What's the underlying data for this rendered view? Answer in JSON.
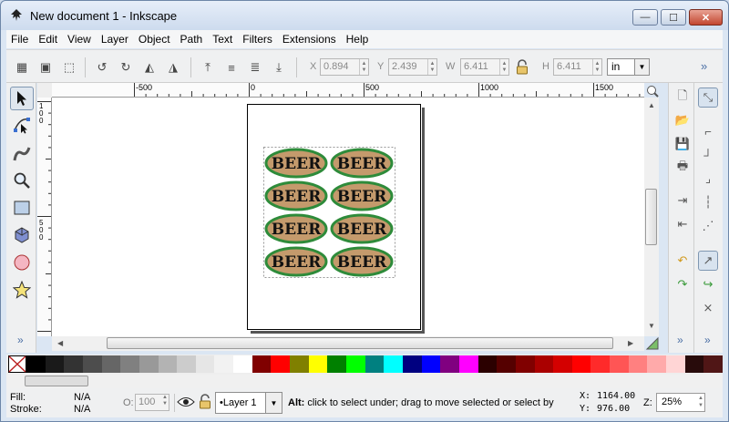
{
  "window": {
    "title": "New document 1 - Inkscape",
    "minimize": "—",
    "maximize": "☐",
    "close": "✕"
  },
  "menu": [
    "File",
    "Edit",
    "View",
    "Layer",
    "Object",
    "Path",
    "Text",
    "Filters",
    "Extensions",
    "Help"
  ],
  "toolbar": {
    "x_label": "X",
    "x_value": "0.894",
    "y_label": "Y",
    "y_value": "2.439",
    "w_label": "W",
    "w_value": "6.411",
    "h_label": "H",
    "h_value": "6.411",
    "unit": "in",
    "overflow": "»"
  },
  "rulers": {
    "h_ticks": [
      "-500",
      "0",
      "500",
      "1000",
      "1500"
    ],
    "v_ticks": [
      "1\n0\n0",
      "5\n0\n0"
    ]
  },
  "canvas": {
    "sticker_text": "BEER",
    "sticker_fill": "#c49a6c",
    "sticker_border": "#2e8b3a"
  },
  "palette_colors": [
    "#000000",
    "#1a1a1a",
    "#333333",
    "#4d4d4d",
    "#666666",
    "#808080",
    "#999999",
    "#b3b3b3",
    "#cccccc",
    "#e6e6e6",
    "#f2f2f2",
    "#ffffff",
    "#800000",
    "#ff0000",
    "#808000",
    "#ffff00",
    "#008000",
    "#00ff00",
    "#008080",
    "#00ffff",
    "#000080",
    "#0000ff",
    "#800080",
    "#ff00ff",
    "#2b0000",
    "#550000",
    "#800000",
    "#aa0000",
    "#d40000",
    "#ff0000",
    "#ff2a2a",
    "#ff5555",
    "#ff8080",
    "#ffaaaa",
    "#ffd5d5",
    "#280b0b",
    "#501616"
  ],
  "status": {
    "fill_label": "Fill:",
    "fill_value": "N/A",
    "stroke_label": "Stroke:",
    "stroke_value": "N/A",
    "opacity_label": "O:",
    "opacity_value": "100",
    "layer": "•Layer 1",
    "message_bold": "Alt:",
    "message": " click to select under; drag to move selected or select by",
    "x_label": "X:",
    "x_value": "1164.00",
    "y_label": "Y:",
    "y_value": "976.00",
    "zoom_label": "Z:",
    "zoom_value": "25%"
  }
}
